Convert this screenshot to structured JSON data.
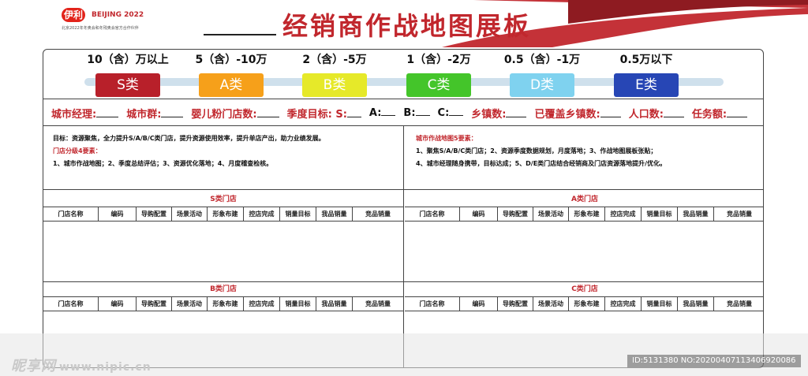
{
  "header": {
    "logo_brand": "伊利",
    "logo_partner": "BEIJING 2022",
    "logo_subtext": "北京2022年冬奥会和冬残奥会官方合作伙伴",
    "title": "经销商作战地图展板"
  },
  "colors": {
    "accent_red": "#c1272d",
    "tier_s": "#b8202a",
    "tier_a": "#f6a01a",
    "tier_b": "#e6e929",
    "tier_c": "#44c52a",
    "tier_d": "#7fd2ef",
    "tier_e": "#2746b5"
  },
  "tiers": [
    {
      "range": "10（含）万以上",
      "label": "S类",
      "color": "#b8202a"
    },
    {
      "range": "5（含）-10万",
      "label": "A类",
      "color": "#f6a01a"
    },
    {
      "range": "2（含）-5万",
      "label": "B类",
      "color": "#e6e929"
    },
    {
      "range": "1（含）-2万",
      "label": "C类",
      "color": "#44c52a"
    },
    {
      "range": "0.5（含）-1万",
      "label": "D类",
      "color": "#7fd2ef"
    },
    {
      "range": "0.5万以下",
      "label": "E类",
      "color": "#2746b5"
    }
  ],
  "info_fields": [
    {
      "label": "城市经理:"
    },
    {
      "label": "城市群:"
    },
    {
      "label": "婴儿粉门店数:"
    },
    {
      "label": "季度目标:  S:"
    },
    {
      "label": "A:"
    },
    {
      "label": "B:"
    },
    {
      "label": "C:"
    },
    {
      "label": "乡镇数:"
    },
    {
      "label": "已覆盖乡镇数:"
    },
    {
      "label": "人口数:"
    },
    {
      "label": "任务额:"
    }
  ],
  "left_goals": {
    "goal_line": "目标：资源聚焦，全力提升S/A/B/C类门店，提升资源使用效率，提升单店产出，助力业绩发展。",
    "heading": "门店分级4要素：",
    "body": "1、城市作战地图；2、季度总结评估；3、资源优化落地；4、月度稽查检核。"
  },
  "right_goals": {
    "heading": "城市作战地图5要素：",
    "body_1": "1、聚焦S/A/B/C类门店；2、资源季度数据规划，月度落地；3、作战地图展板张贴；",
    "body_2": "4、城市经理随身携带，目标达成；5、D/E类门店结合经销商及门店资源落地提升/优化。"
  },
  "columns": [
    "门店名称",
    "编码",
    "导购配置",
    "场景活动",
    "形象布建",
    "控店完成",
    "销量目标",
    "我品销量",
    "竞品销量"
  ],
  "sections": {
    "s": {
      "title": "S类门店"
    },
    "a": {
      "title": "A类门店"
    },
    "b": {
      "title": "B类门店"
    },
    "c": {
      "title": "C类门店"
    }
  },
  "watermark": {
    "brand": "昵享网",
    "url": "www.nipic.cn",
    "id": "ID:5131380 NO:20200407113406920086"
  }
}
